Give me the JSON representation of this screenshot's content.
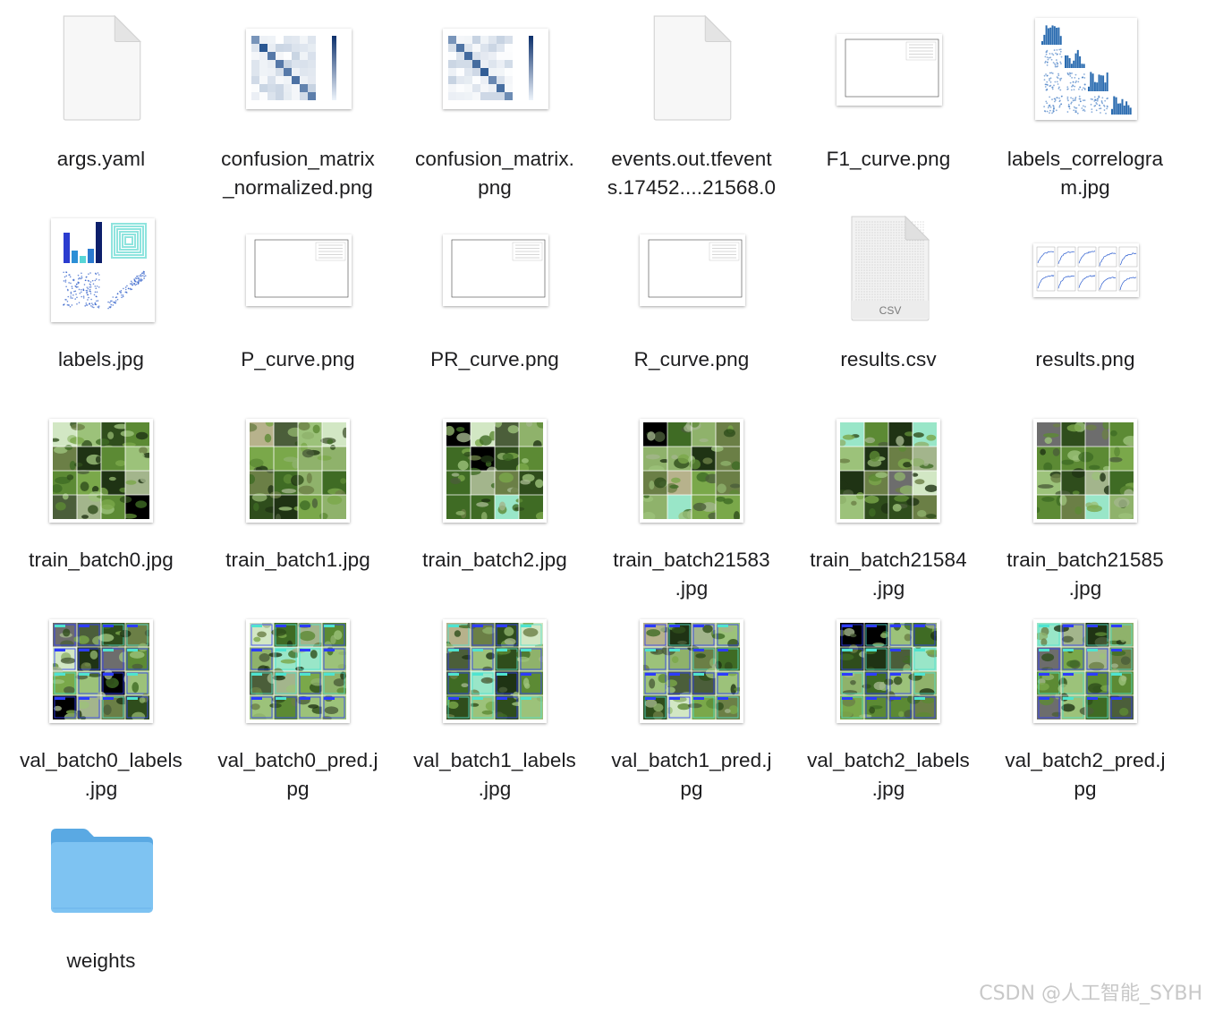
{
  "files": [
    {
      "name": "args.yaml",
      "line1": "args.yaml",
      "line2": "",
      "kind": "document"
    },
    {
      "name": "confusion_matrix_normalized.png",
      "line1": "confusion_matrix",
      "line2": "_normalized.png",
      "kind": "matrix"
    },
    {
      "name": "confusion_matrix.png",
      "line1": "confusion_matrix.",
      "line2": "png",
      "kind": "matrix"
    },
    {
      "name": "events.out.tfevents.17452....21568.0",
      "line1": "events.out.tfevent",
      "line2": "s.17452....21568.0",
      "kind": "document"
    },
    {
      "name": "F1_curve.png",
      "line1": "F1_curve.png",
      "line2": "",
      "kind": "curve"
    },
    {
      "name": "labels_correlogram.jpg",
      "line1": "labels_correlogra",
      "line2": "m.jpg",
      "kind": "correlogram"
    },
    {
      "name": "labels.jpg",
      "line1": "labels.jpg",
      "line2": "",
      "kind": "labels"
    },
    {
      "name": "P_curve.png",
      "line1": "P_curve.png",
      "line2": "",
      "kind": "curve"
    },
    {
      "name": "PR_curve.png",
      "line1": "PR_curve.png",
      "line2": "",
      "kind": "curve"
    },
    {
      "name": "R_curve.png",
      "line1": "R_curve.png",
      "line2": "",
      "kind": "curve"
    },
    {
      "name": "results.csv",
      "line1": "results.csv",
      "line2": "",
      "kind": "csv",
      "badge": "CSV"
    },
    {
      "name": "results.png",
      "line1": "results.png",
      "line2": "",
      "kind": "results"
    },
    {
      "name": "train_batch0.jpg",
      "line1": "train_batch0.jpg",
      "line2": "",
      "kind": "mosaic"
    },
    {
      "name": "train_batch1.jpg",
      "line1": "train_batch1.jpg",
      "line2": "",
      "kind": "mosaic"
    },
    {
      "name": "train_batch2.jpg",
      "line1": "train_batch2.jpg",
      "line2": "",
      "kind": "mosaic"
    },
    {
      "name": "train_batch21583.jpg",
      "line1": "train_batch21583",
      "line2": ".jpg",
      "kind": "mosaic"
    },
    {
      "name": "train_batch21584.jpg",
      "line1": "train_batch21584",
      "line2": ".jpg",
      "kind": "mosaic"
    },
    {
      "name": "train_batch21585.jpg",
      "line1": "train_batch21585",
      "line2": ".jpg",
      "kind": "mosaic"
    },
    {
      "name": "val_batch0_labels.jpg",
      "line1": "val_batch0_labels",
      "line2": ".jpg",
      "kind": "val"
    },
    {
      "name": "val_batch0_pred.jpg",
      "line1": "val_batch0_pred.j",
      "line2": "pg",
      "kind": "val"
    },
    {
      "name": "val_batch1_labels.jpg",
      "line1": "val_batch1_labels",
      "line2": ".jpg",
      "kind": "val"
    },
    {
      "name": "val_batch1_pred.jpg",
      "line1": "val_batch1_pred.j",
      "line2": "pg",
      "kind": "val"
    },
    {
      "name": "val_batch2_labels.jpg",
      "line1": "val_batch2_labels",
      "line2": ".jpg",
      "kind": "val"
    },
    {
      "name": "val_batch2_pred.jpg",
      "line1": "val_batch2_pred.j",
      "line2": "pg",
      "kind": "val"
    },
    {
      "name": "weights",
      "line1": "weights",
      "line2": "",
      "kind": "folder"
    }
  ],
  "watermark": "CSDN @人工智能_SYBH",
  "colors": {
    "folder_body": "#7ec3f2",
    "folder_tab": "#5aa9e3",
    "matrix_blue": "#1f4e8c",
    "leaf_green": "#4f7a2e",
    "label_text": "#1d1d1f"
  },
  "icons": [
    "document-icon",
    "folder-icon",
    "image-thumbnail-icon",
    "csv-document-icon"
  ]
}
